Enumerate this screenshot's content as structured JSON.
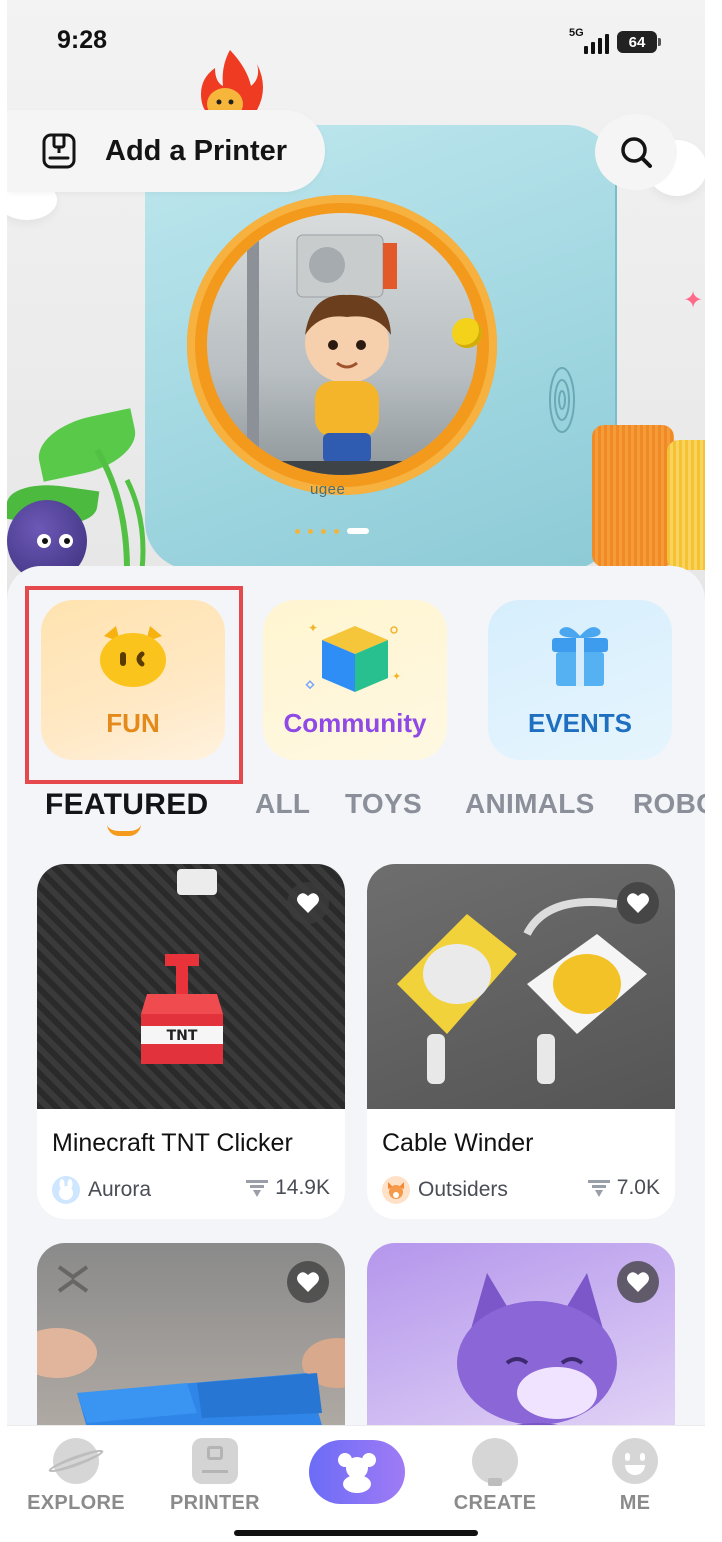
{
  "status_bar": {
    "time": "9:28",
    "network": "5G",
    "battery": "64"
  },
  "hero": {
    "add_printer_label": "Add a Printer",
    "printer_brand": "ugee",
    "carousel_pages": 5,
    "carousel_active": 4
  },
  "categories": [
    {
      "label": "FUN",
      "icon": "cat-face-icon"
    },
    {
      "label": "Community",
      "icon": "cube-icon"
    },
    {
      "label": "EVENTS",
      "icon": "gift-icon"
    }
  ],
  "tabs": [
    {
      "label": "FEATURED",
      "active": true
    },
    {
      "label": "ALL"
    },
    {
      "label": "TOYS"
    },
    {
      "label": "ANIMALS"
    },
    {
      "label": "ROBO"
    }
  ],
  "models": [
    {
      "title": "Minecraft TNT Clicker",
      "author": "Aurora",
      "downloads": "14.9K"
    },
    {
      "title": "Cable Winder",
      "author": "Outsiders",
      "downloads": "7.0K"
    }
  ],
  "bottom_nav": {
    "explore": "EXPLORE",
    "printer": "PRINTER",
    "create": "CREATE",
    "me": "ME"
  },
  "colors": {
    "accent_orange": "#f49b1e",
    "highlight_red": "#e5484d",
    "community_purple": "#8e49e6",
    "events_blue": "#1f6fc1"
  }
}
